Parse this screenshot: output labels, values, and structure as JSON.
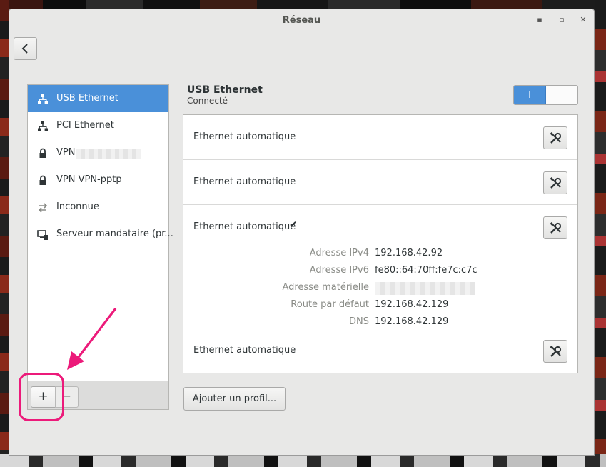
{
  "window": {
    "title": "Réseau",
    "minimize_glyph": "▪",
    "maximize_glyph": "▫",
    "close_glyph": "✕"
  },
  "sidebar": {
    "items": [
      {
        "label": "USB Ethernet",
        "icon": "wired-network-icon",
        "selected": true
      },
      {
        "label": "PCI Ethernet",
        "icon": "wired-network-icon",
        "selected": false
      },
      {
        "label": "VPN",
        "icon": "lock-icon",
        "selected": false
      },
      {
        "label": "VPN VPN-pptp",
        "icon": "lock-icon",
        "selected": false
      },
      {
        "label": "Inconnue",
        "icon": "transfer-arrows-icon",
        "selected": false
      },
      {
        "label": "Serveur mandataire (pr...",
        "icon": "proxy-computer-icon",
        "selected": false
      }
    ],
    "add_label": "+",
    "remove_label": "−"
  },
  "device": {
    "name": "USB Ethernet",
    "status": "Connecté",
    "switch_label": "I",
    "enabled": true
  },
  "profiles": [
    {
      "name": "Ethernet automatique",
      "active": false
    },
    {
      "name": "Ethernet automatique",
      "active": false
    },
    {
      "name": "Ethernet automatique",
      "active": true,
      "check": "✔",
      "details": [
        {
          "key": "Adresse IPv4",
          "value": "192.168.42.92"
        },
        {
          "key": "Adresse IPv6",
          "value": "fe80::64:70ff:fe7c:c7c"
        },
        {
          "key": "Adresse matérielle",
          "value": ""
        },
        {
          "key": "Route par défaut",
          "value": "192.168.42.129"
        },
        {
          "key": "DNS",
          "value": "192.168.42.129"
        }
      ]
    },
    {
      "name": "Ethernet automatique",
      "active": false
    }
  ],
  "add_profile_label": "Ajouter un profil...",
  "colors": {
    "selection": "#4a90d9",
    "annotation": "#ec1a7a"
  }
}
